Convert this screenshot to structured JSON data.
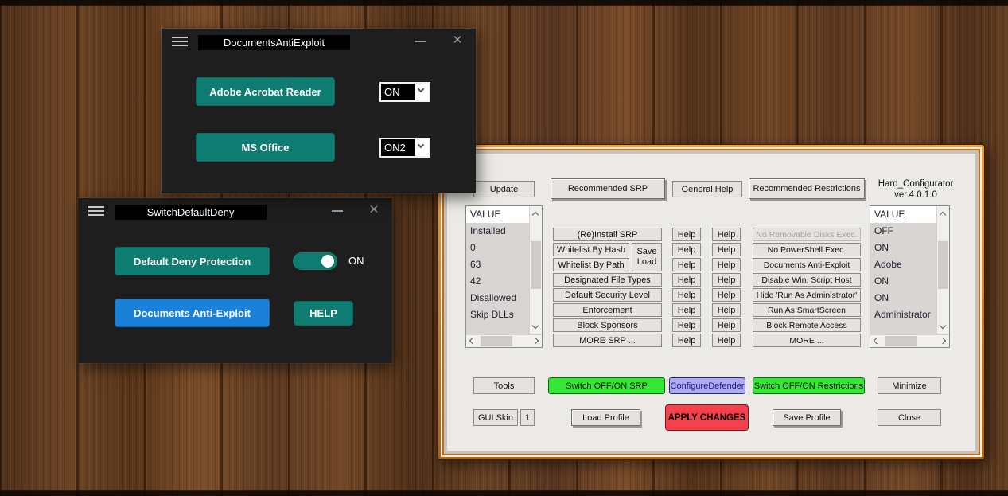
{
  "colors": {
    "teal": "#0e7c71",
    "blue": "#1a80d8",
    "green": "#35e835",
    "lavender": "#b2aaf0",
    "red": "#f4414b",
    "frame_orange": "#c06c15",
    "dark_window_bg": "#1e1e1e"
  },
  "windows": {
    "documents_anti_exploit": {
      "title": "DocumentsAntiExploit",
      "adobe_button": "Adobe Acrobat Reader",
      "adobe_value": "ON",
      "office_button": "MS Office",
      "office_value": "ON2"
    },
    "switch_default_deny": {
      "title": "SwitchDefaultDeny",
      "default_deny_button": "Default Deny Protection",
      "toggle_state": "ON",
      "docs_anti_exploit_button": "Documents Anti-Exploit",
      "help_button": "HELP"
    },
    "hard_configurator": {
      "title_line1": "Hard_Configurator",
      "title_line2": "ver.4.0.1.0",
      "update": "Update",
      "recommended_srp": "Recommended SRP",
      "general_help": "General Help",
      "recommended_restrictions": "Recommended Restrictions",
      "left_list": {
        "header": "VALUE",
        "items": [
          "Installed",
          "0",
          "63",
          "42",
          "Disallowed",
          "Skip DLLs"
        ]
      },
      "right_list": {
        "header": "VALUE",
        "items": [
          "OFF",
          "ON",
          "Adobe",
          "ON",
          "ON",
          "Administrator"
        ]
      },
      "srp_buttons": [
        "(Re)Install SRP",
        "Whitelist By Hash",
        "Whitelist By Path",
        "Designated File Types",
        "Default Security Level",
        "Enforcement",
        "Block Sponsors",
        "MORE SRP ..."
      ],
      "save_load_line1": "Save",
      "save_load_line2": "Load",
      "help": "Help",
      "restriction_buttons": [
        "No Removable Disks Exec.",
        "No PowerShell Exec.",
        "Documents Anti-Exploit",
        "Disable Win. Script Host",
        "Hide 'Run As Administrator'",
        "Run As SmartScreen",
        "Block Remote Access",
        "MORE ..."
      ],
      "tools": "Tools",
      "switch_srp": "Switch OFF/ON SRP",
      "configure_defender": "ConfigureDefender",
      "switch_restrictions": "Switch OFF/ON Restrictions",
      "minimize": "Minimize",
      "gui_skin": "GUI Skin",
      "gui_skin_value": "1",
      "load_profile": "Load Profile",
      "apply_changes": "APPLY CHANGES",
      "save_profile": "Save Profile",
      "close": "Close"
    }
  }
}
